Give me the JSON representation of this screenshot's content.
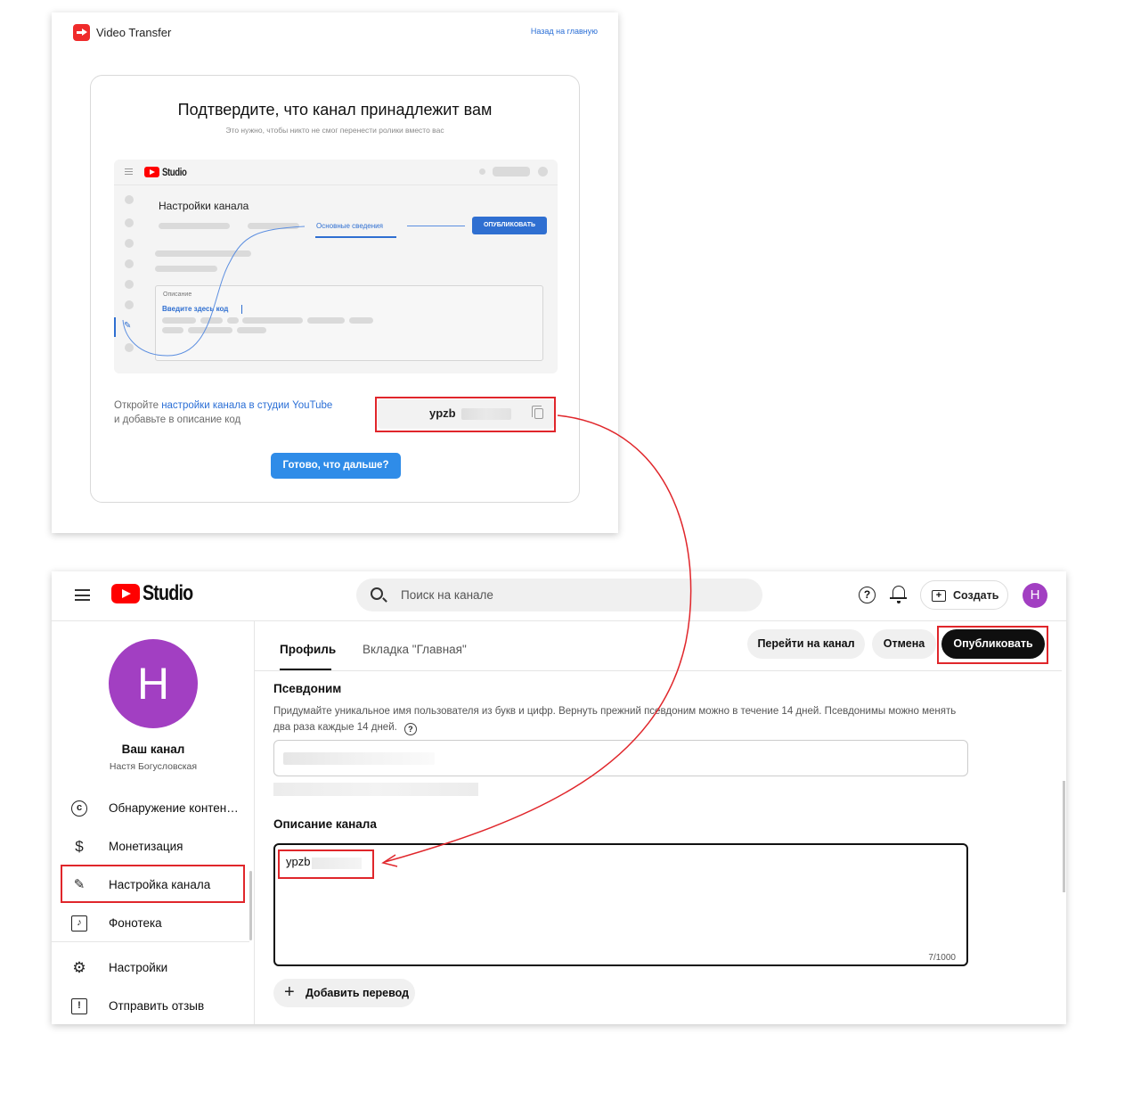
{
  "video_transfer": {
    "app_name": "Video Transfer",
    "back_link": "Назад на главную",
    "title": "Подтвердите, что канал принадлежит вам",
    "subtitle": "Это нужно, чтобы никто не смог перенести ролики вместо вас",
    "mockup": {
      "studio_label": "Studio",
      "settings_title": "Настройки канала",
      "active_tab": "Основные сведения",
      "publish": "ОПУБЛИКОВАТЬ",
      "description_label": "Описание",
      "code_placeholder": "Введите здесь код"
    },
    "instruction_prefix": "Откройте ",
    "instruction_link": "настройки канала в студии YouTube",
    "instruction_suffix": "и добавьте в описание код",
    "code_visible": "ypzb",
    "ready_button": "Готово, что дальше?"
  },
  "studio": {
    "logo_text": "Studio",
    "search_placeholder": "Поиск на канале",
    "create_label": "Создать",
    "avatar_letter": "Н",
    "sidebar": {
      "channel_label": "Ваш канал",
      "channel_name": "Настя Богусловская",
      "items": [
        {
          "label": "Обнаружение контен…",
          "icon": "copyright-icon"
        },
        {
          "label": "Монетизация",
          "icon": "dollar-icon"
        },
        {
          "label": "Настройка канала",
          "icon": "magic-wand-icon"
        },
        {
          "label": "Фонотека",
          "icon": "music-library-icon"
        },
        {
          "label": "Настройки",
          "icon": "gear-icon"
        },
        {
          "label": "Отправить отзыв",
          "icon": "feedback-icon"
        }
      ]
    },
    "tabs": [
      "Профиль",
      "Вкладка \"Главная\""
    ],
    "buttons": {
      "go_to_channel": "Перейти на канал",
      "cancel": "Отмена",
      "publish": "Опубликовать"
    },
    "nickname_title": "Псевдоним",
    "nickname_help": "Придумайте уникальное имя пользователя из букв и цифр. Вернуть прежний псевдоним можно в течение 14 дней. Псевдонимы можно менять два раза каждые 14 дней.",
    "description_title": "Описание канала",
    "description_value": "ypzb",
    "char_counter": "7/1000",
    "add_translation": "Добавить перевод"
  },
  "colors": {
    "highlight": "#e0262b",
    "accent_blue": "#2f8ce8",
    "avatar_purple": "#a23fc2",
    "youtube_red": "#ff0000"
  }
}
